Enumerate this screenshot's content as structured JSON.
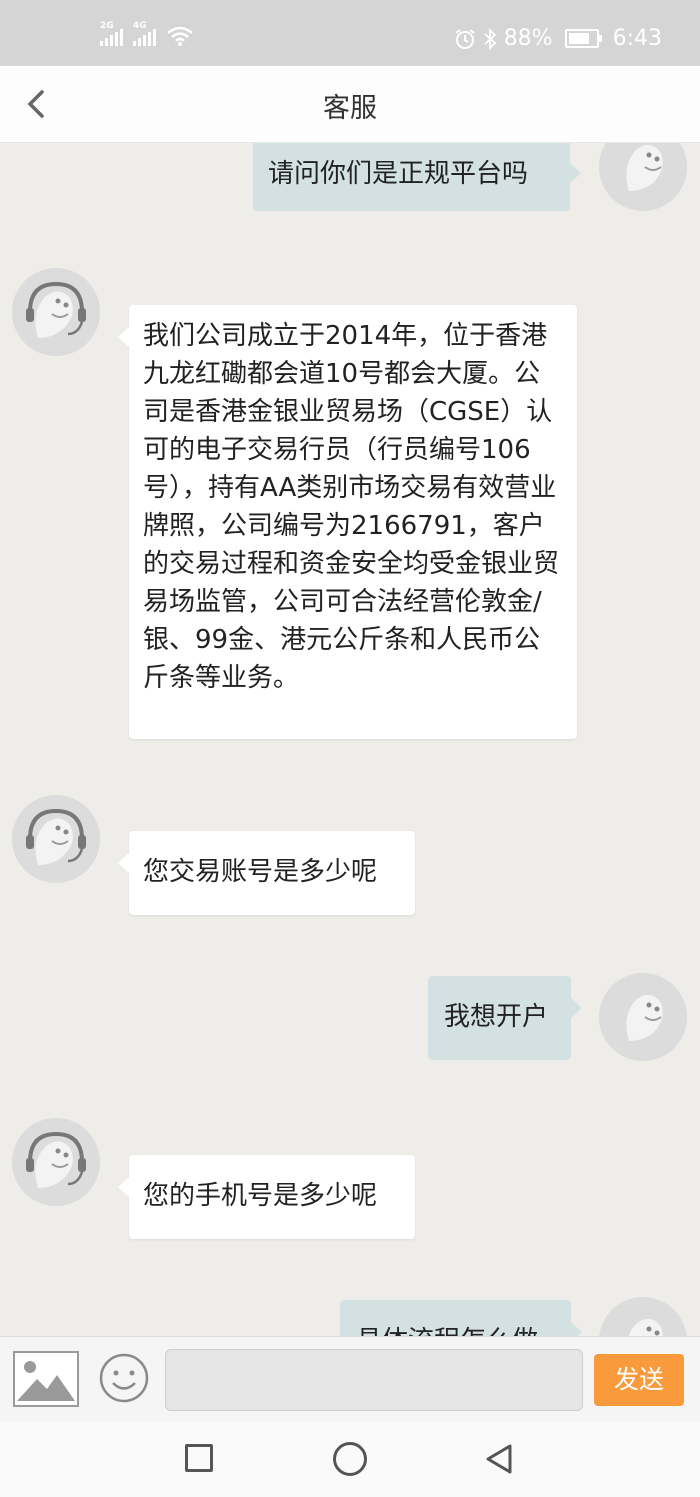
{
  "status_bar": {
    "signal1_tag": "2G",
    "signal2_tag": "4G",
    "battery_percent": "88%",
    "time": "6:43"
  },
  "header": {
    "title": "客服",
    "back_icon": "chevron-left-icon"
  },
  "messages": [
    {
      "side": "right",
      "text": "请问你们是正规平台吗"
    },
    {
      "side": "left",
      "text": "我们公司成立于2014年，位于香港九龙红磡都会道10号都会大厦。公司是香港金银业贸易场（CGSE）认可的电子交易行员（行员编号106号），持有AA类别市场交易有效营业牌照，公司编号为2166791，客户的交易过程和资金安全均受金银业贸易场监管，公司可合法经营伦敦金/银、99金、港元公斤条和人民币公斤条等业务。"
    },
    {
      "side": "left",
      "text": "您交易账号是多少呢"
    },
    {
      "side": "right",
      "text": "我想开户"
    },
    {
      "side": "left",
      "text": "您的手机号是多少呢"
    },
    {
      "side": "right",
      "text": "具体流程怎么做"
    }
  ],
  "input_bar": {
    "image_icon": "image-icon",
    "emoji_icon": "smiley-icon",
    "input_value": "",
    "send_label": "发送"
  },
  "nav_bar": {
    "recent_icon": "square-icon",
    "home_icon": "circle-icon",
    "back_icon": "triangle-back-icon"
  },
  "colors": {
    "accent_send": "#f99b3c",
    "bubble_right": "#d4e1e2",
    "bubble_left": "#ffffff",
    "chat_bg": "#efedea"
  }
}
